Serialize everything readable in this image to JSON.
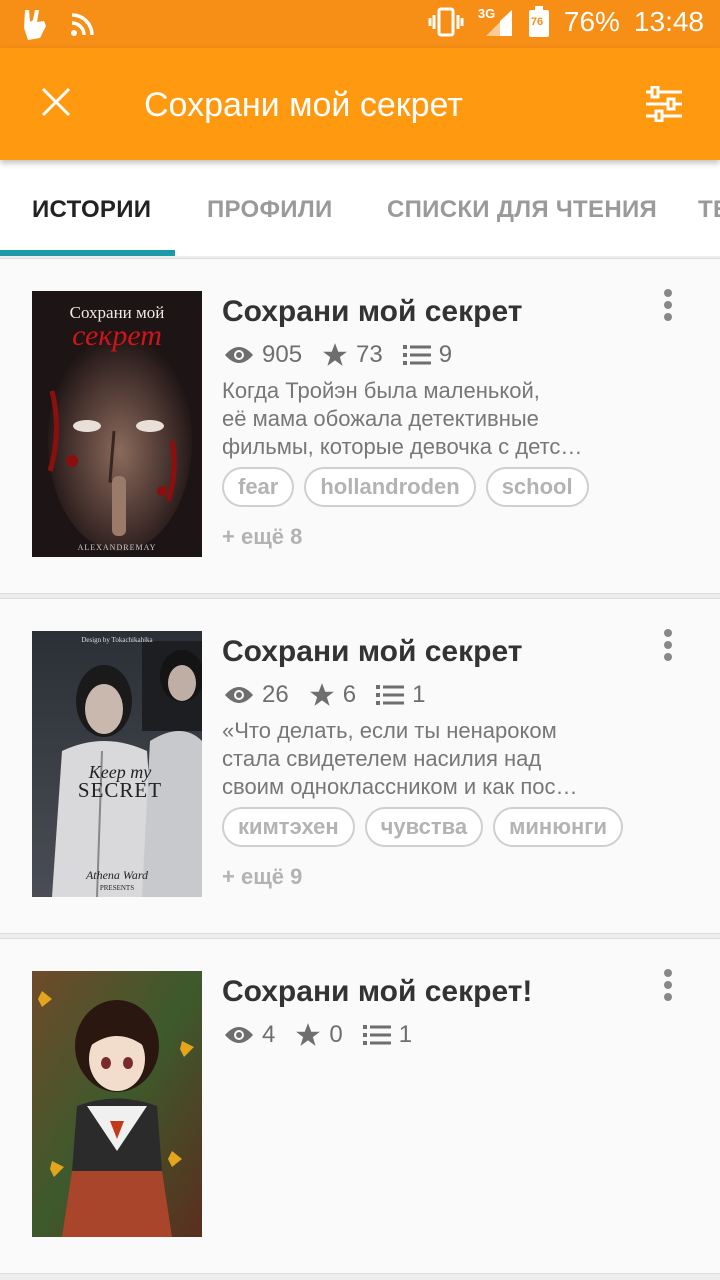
{
  "status_bar": {
    "battery": "76%",
    "time": "13:48",
    "network": "3G",
    "battery_level_label": "76"
  },
  "app_bar": {
    "title": "Сохрани мой секрет"
  },
  "tabs": [
    {
      "label": "ИСТОРИИ"
    },
    {
      "label": "ПРОФИЛИ"
    },
    {
      "label": "СПИСКИ ДЛЯ ЧТЕНИЯ"
    },
    {
      "label": "ТЕ"
    }
  ],
  "stories": [
    {
      "title": "Сохрани мой секрет",
      "views": "905",
      "votes": "73",
      "parts": "9",
      "description": [
        "Когда Тройэн была маленькой,",
        "её мама обожала детективные",
        "фильмы, которые девочка с детс…"
      ],
      "tags": [
        "fear",
        "hollandroden",
        "school"
      ],
      "more_tags": "+ ещё 8",
      "cover_text": {
        "title_line1": "Сохрани мой",
        "title_line2": "секрет",
        "author": "ALEXANDREMAY"
      }
    },
    {
      "title": "Сохрани мой секрет",
      "views": "26",
      "votes": "6",
      "parts": "1",
      "description": [
        "«Что делать, если ты ненароком",
        "стала свидетелем насилия над",
        "своим одноклассником и как пос…"
      ],
      "tags": [
        "кимтэхен",
        "чувства",
        "минюнги"
      ],
      "more_tags": "+ ещё 9",
      "cover_text": {
        "top": "Design by Tokachikahika",
        "line1": "Keep my",
        "line2": "SECRET",
        "author": "Athena Ward",
        "presents": "PRESENTS"
      }
    },
    {
      "title": "Сохрани мой секрет!",
      "views": "4",
      "votes": "0",
      "parts": "1"
    }
  ],
  "colors": {
    "status_bar": "#f78e16",
    "app_bar": "#ff9910",
    "tab_indicator": "#1d9aaa"
  }
}
